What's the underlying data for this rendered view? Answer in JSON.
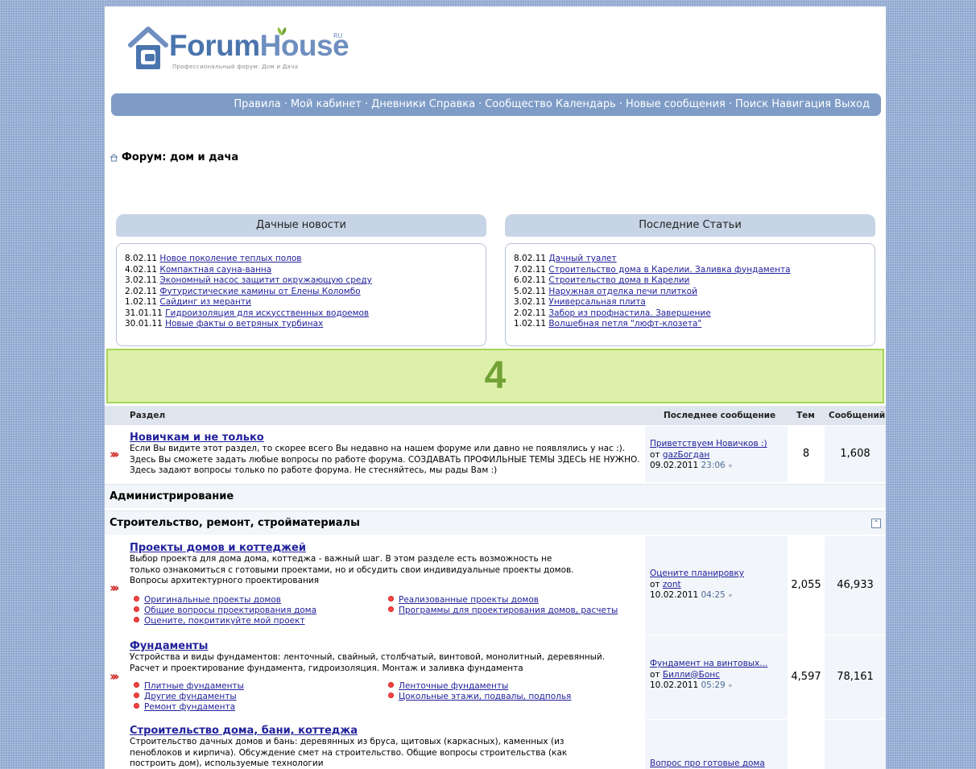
{
  "logo": {
    "brand_a": "Forum",
    "brand_b": "House",
    "suffix": "RU",
    "tagline": "Профессиональный форум: Дом и Дача"
  },
  "nav": {
    "items": [
      "Правила",
      "Мой кабинет",
      "Дневники Справка",
      "Сообщество Календарь",
      "Новые сообщения",
      "Поиск Навигация Выход"
    ]
  },
  "breadcrumb": {
    "title": "Форум: дом и дача"
  },
  "news": {
    "title": "Дачные новости",
    "items": [
      {
        "date": "8.02.11",
        "text": "Новое поколение теплых полов"
      },
      {
        "date": "4.02.11",
        "text": "Компактная сауна-ванна"
      },
      {
        "date": "3.02.11",
        "text": "Экономный насос защитит окружающую среду"
      },
      {
        "date": "2.02.11",
        "text": "Футуристические камины от Елены Коломбо"
      },
      {
        "date": "1.02.11",
        "text": "Сайдинг из меранти"
      },
      {
        "date": "31.01.11",
        "text": "Гидроизоляция для искусственных водоемов"
      },
      {
        "date": "30.01.11",
        "text": "Новые факты о ветряных турбинах"
      }
    ]
  },
  "articles": {
    "title": "Последние Статьи",
    "items": [
      {
        "date": "8.02.11",
        "text": "Дачный туалет"
      },
      {
        "date": "7.02.11",
        "text": "Строительство дома в Карелии. Заливка фундамента"
      },
      {
        "date": "6.02.11",
        "text": "Строительство дома в Карелии"
      },
      {
        "date": "5.02.11",
        "text": "Наружная отделка печи плиткой"
      },
      {
        "date": "3.02.11",
        "text": "Универсальная плита"
      },
      {
        "date": "2.02.11",
        "text": "Забор из профнастила. Завершение"
      },
      {
        "date": "1.02.11",
        "text": "Волшебная петля \"люфт-клозета\""
      }
    ]
  },
  "banner": {
    "text": "4"
  },
  "table": {
    "col_section": "Раздел",
    "col_last": "Последнее сообщение",
    "col_threads": "Тем",
    "col_posts": "Сообщений"
  },
  "forums": {
    "newbies": {
      "title": "Новичкам и не только",
      "desc": "Если Вы видите этот раздел, то скорее всего Вы недавно на нашем форуме или давно не появлялись у нас :). Здесь Вы сможете задать любые вопросы по работе форума. СОЗДАВАТЬ ПРОФИЛЬНЫЕ ТЕМЫ ЗДЕСЬ НЕ НУЖНО. Здесь задают вопросы только по работе форума. Не стесняйтесь, мы рады Вам :)",
      "last_title": "Приветствуем Новичков :)",
      "by": "от",
      "last_user": "gazБогдан",
      "last_date": "09.02.2011",
      "last_time": "23:06",
      "threads": "8",
      "posts": "1,608"
    },
    "cat_admin": "Администрирование",
    "cat_build": "Строительство, ремонт, стройматериалы",
    "projects": {
      "title": "Проекты домов и коттеджей",
      "desc": "Выбор проекта для дома дома, коттеджа - важный шаг. В этом разделе есть возможность не только ознакомиться с готовыми проектами, но и обсудить свои индивидуальные проекты домов. Вопросы архитектурного проектирования",
      "subs": [
        "Оригинальные проекты домов",
        "Реализованные проекты домов",
        "Общие вопросы проектирования дома",
        "Программы для проектирования домов, расчеты",
        "Оцените, покритикуйте мой проект"
      ],
      "last_title": "Оцените планировку",
      "by": "от",
      "last_user": "zont",
      "last_date": "10.02.2011",
      "last_time": "04:25",
      "threads": "2,055",
      "posts": "46,933"
    },
    "foundations": {
      "title": "Фундаменты",
      "desc": "Устройства и виды фундаментов: ленточный, свайный, столбчатый, винтовой, монолитный, деревянный. Расчет и проектирование фундамента, гидроизоляция. Монтаж и заливка фундамента",
      "subs": [
        "Плитные фундаменты",
        "Ленточные фундаменты",
        "Другие фундаменты",
        "Цокольные этажи, подвалы, подполья",
        "Ремонт фундамента"
      ],
      "last_title": "Фундамент на винтовых...",
      "by": "от",
      "last_user": "Билли@Бонс",
      "last_date": "10.02.2011",
      "last_time": "05:29",
      "threads": "4,597",
      "posts": "78,161"
    },
    "building": {
      "title": "Строительство дома, бани, коттеджа",
      "desc": "Строительство дачных домов и бань: деревянных из бруса, щитовых (каркасных), каменных (из пеноблоков и кирпича). Обсуждение смет на строительство. Общие вопросы строительства (как построить дом), используемые технологии",
      "last_title": "Вопрос про готовые дома"
    }
  }
}
